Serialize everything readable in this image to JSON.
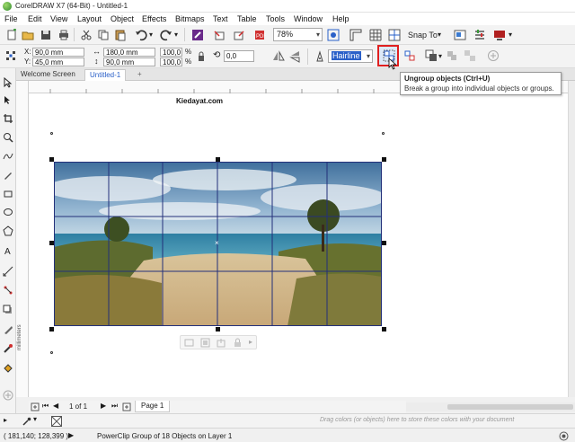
{
  "window": {
    "title": "CorelDRAW X7 (64-Bit) - Untitled-1"
  },
  "menu": [
    "File",
    "Edit",
    "View",
    "Layout",
    "Object",
    "Effects",
    "Bitmaps",
    "Text",
    "Table",
    "Tools",
    "Window",
    "Help"
  ],
  "toolbar": {
    "zoom": "78%",
    "snap_to": "Snap To"
  },
  "property_bar": {
    "x_label": "X:",
    "x_value": "90,0 mm",
    "y_label": "Y:",
    "y_value": "45,0 mm",
    "width_value": "180,0 mm",
    "height_value": "90,0 mm",
    "scale_w": "100,0",
    "scale_h": "100,0",
    "percent": "%",
    "rotation": "0,0",
    "outline": "Hairline"
  },
  "tabs": {
    "welcome": "Welcome Screen",
    "doc": "Untitled-1",
    "add": "+"
  },
  "tooltip": {
    "title": "Ungroup objects (Ctrl+U)",
    "body": "Break a group into individual objects or groups."
  },
  "document": {
    "watermark": "Kiedayat.com"
  },
  "page_nav": {
    "counter": "1 of 1",
    "page_tab": "Page 1"
  },
  "palette": {
    "hint": "Drag colors (or objects) here to store these colors with your document"
  },
  "status": {
    "coords": "( 181,140; 128,399 )",
    "message": "PowerClip Group of 18 Objects on Layer 1"
  },
  "ruler": {
    "unit": "millimeters"
  },
  "colors": {
    "accent": "#2a60c8",
    "highlight_box": "#e02020",
    "grid_line": "#23307a"
  }
}
